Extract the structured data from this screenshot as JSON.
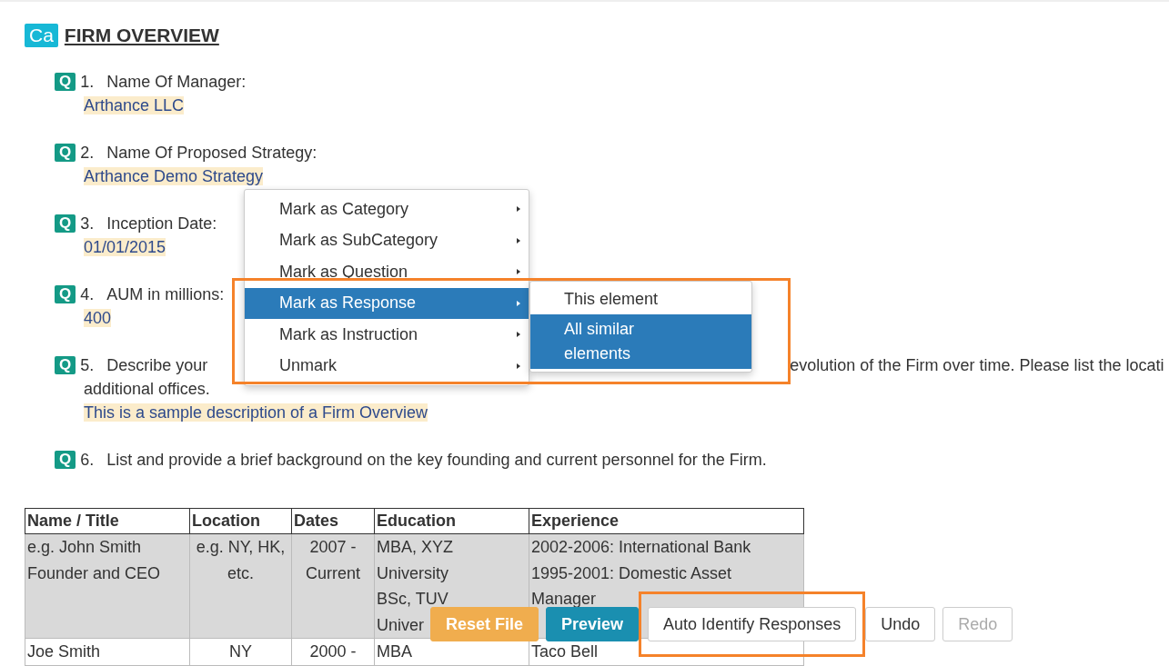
{
  "category": {
    "badge": "Ca",
    "title": "FIRM OVERVIEW"
  },
  "questions": [
    {
      "badge": "Q",
      "number": "1.",
      "text": [
        "Name Of Manager:"
      ],
      "response": "Arthance LLC"
    },
    {
      "badge": "Q",
      "number": "2.",
      "text": [
        "Name Of Proposed Strategy:"
      ],
      "response": "Arthance Demo Strategy"
    },
    {
      "badge": "Q",
      "number": "3.",
      "text": [
        "Inception Date:"
      ],
      "response": "01/01/2015"
    },
    {
      "badge": "Q",
      "number": "4.",
      "text": [
        "AUM in millions:"
      ],
      "response": "400"
    },
    {
      "badge": "Q",
      "number": "5.",
      "text": [
        "Describe your",
        "evolution of the Firm over time. Please list the locati"
      ],
      "more": [
        "additional offices."
      ],
      "response": "This is a sample description of a Firm Overview"
    },
    {
      "badge": "Q",
      "number": "6.",
      "text": [
        "List and provide a brief background on the key founding and current personnel for the Firm."
      ]
    }
  ],
  "table": {
    "columns": [
      "Name / Title",
      "Location",
      "Dates",
      "Education",
      "Experience"
    ],
    "rows": [
      {
        "shaded": true,
        "cells": [
          [
            "e.g. John Smith",
            "Founder and CEO"
          ],
          [
            "e.g. NY, HK,",
            "etc."
          ],
          [
            "2007 -",
            "Current"
          ],
          [
            "MBA, XYZ",
            "University",
            "BSc, TUV",
            "Univer"
          ],
          [
            "2002-2006: International Bank",
            "1995-2001: Domestic Asset",
            "Manager"
          ]
        ]
      },
      {
        "shaded": false,
        "cells": [
          [
            "Joe Smith"
          ],
          [
            "NY"
          ],
          [
            "2000 -"
          ],
          [
            "MBA"
          ],
          [
            "Taco Bell"
          ]
        ]
      }
    ]
  },
  "context_menu": {
    "items": [
      {
        "label": "Mark as Category",
        "selected": false
      },
      {
        "label": "Mark as SubCategory",
        "selected": false
      },
      {
        "label": "Mark as Question",
        "selected": false
      },
      {
        "label": "Mark as Response",
        "selected": true
      },
      {
        "label": "Mark as Instruction",
        "selected": false
      },
      {
        "label": "Unmark",
        "selected": false
      }
    ]
  },
  "submenu": {
    "items": [
      {
        "label": "This element",
        "selected": false
      },
      {
        "label": "All similar elements",
        "selected": true
      }
    ]
  },
  "toolbar": {
    "buttons": [
      {
        "label": "Reset File",
        "kind": "warning",
        "disabled": false,
        "highlighted": false
      },
      {
        "label": "Preview",
        "kind": "info",
        "disabled": false,
        "highlighted": false
      },
      {
        "label": "Auto Identify Responses",
        "kind": "default",
        "disabled": false,
        "highlighted": true
      },
      {
        "label": "Undo",
        "kind": "default",
        "disabled": false,
        "highlighted": false
      },
      {
        "label": "Redo",
        "kind": "default",
        "disabled": true,
        "highlighted": false
      }
    ]
  }
}
